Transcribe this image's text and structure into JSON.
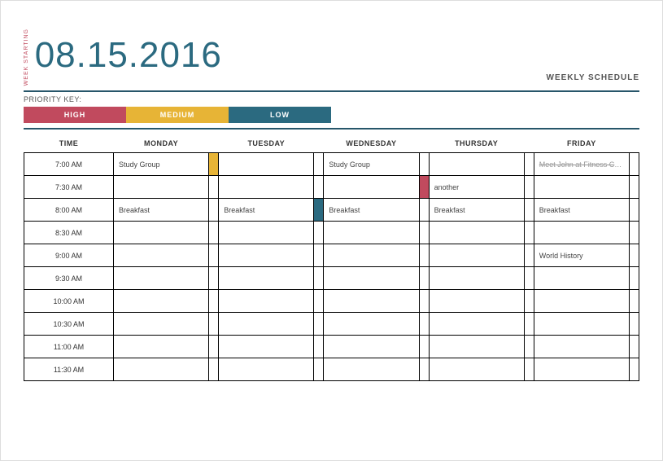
{
  "header": {
    "week_starting_label": "WEEK STARTING",
    "date": "08.15.2016",
    "weekly_label": "WEEKLY SCHEDULE"
  },
  "priority": {
    "label": "PRIORITY KEY:",
    "high": "HIGH",
    "medium": "MEDIUM",
    "low": "LOW"
  },
  "columns": {
    "time": "TIME",
    "monday": "MONDAY",
    "tuesday": "TUESDAY",
    "wednesday": "WEDNESDAY",
    "thursday": "THURSDAY",
    "friday": "FRIDAY"
  },
  "times": [
    "7:00 AM",
    "7:30 AM",
    "8:00 AM",
    "8:30 AM",
    "9:00 AM",
    "9:30 AM",
    "10:00 AM",
    "10:30 AM",
    "11:00 AM",
    "11:30 AM"
  ],
  "events": {
    "r0": {
      "mon": "Study Group",
      "wed": "Study Group",
      "fri": "Meet John at Fitness Center"
    },
    "r1": {
      "thu": "another"
    },
    "r2": {
      "mon": "Breakfast",
      "tue": "Breakfast",
      "wed": "Breakfast",
      "thu": "Breakfast",
      "fri": "Breakfast"
    },
    "r4": {
      "fri": "World History"
    }
  },
  "chips": {
    "r0_mon": "medium",
    "r1_wed": "high",
    "r2_tue": "low"
  },
  "colors": {
    "high": "#c14a5e",
    "medium": "#e7b436",
    "low": "#2b6a80"
  }
}
